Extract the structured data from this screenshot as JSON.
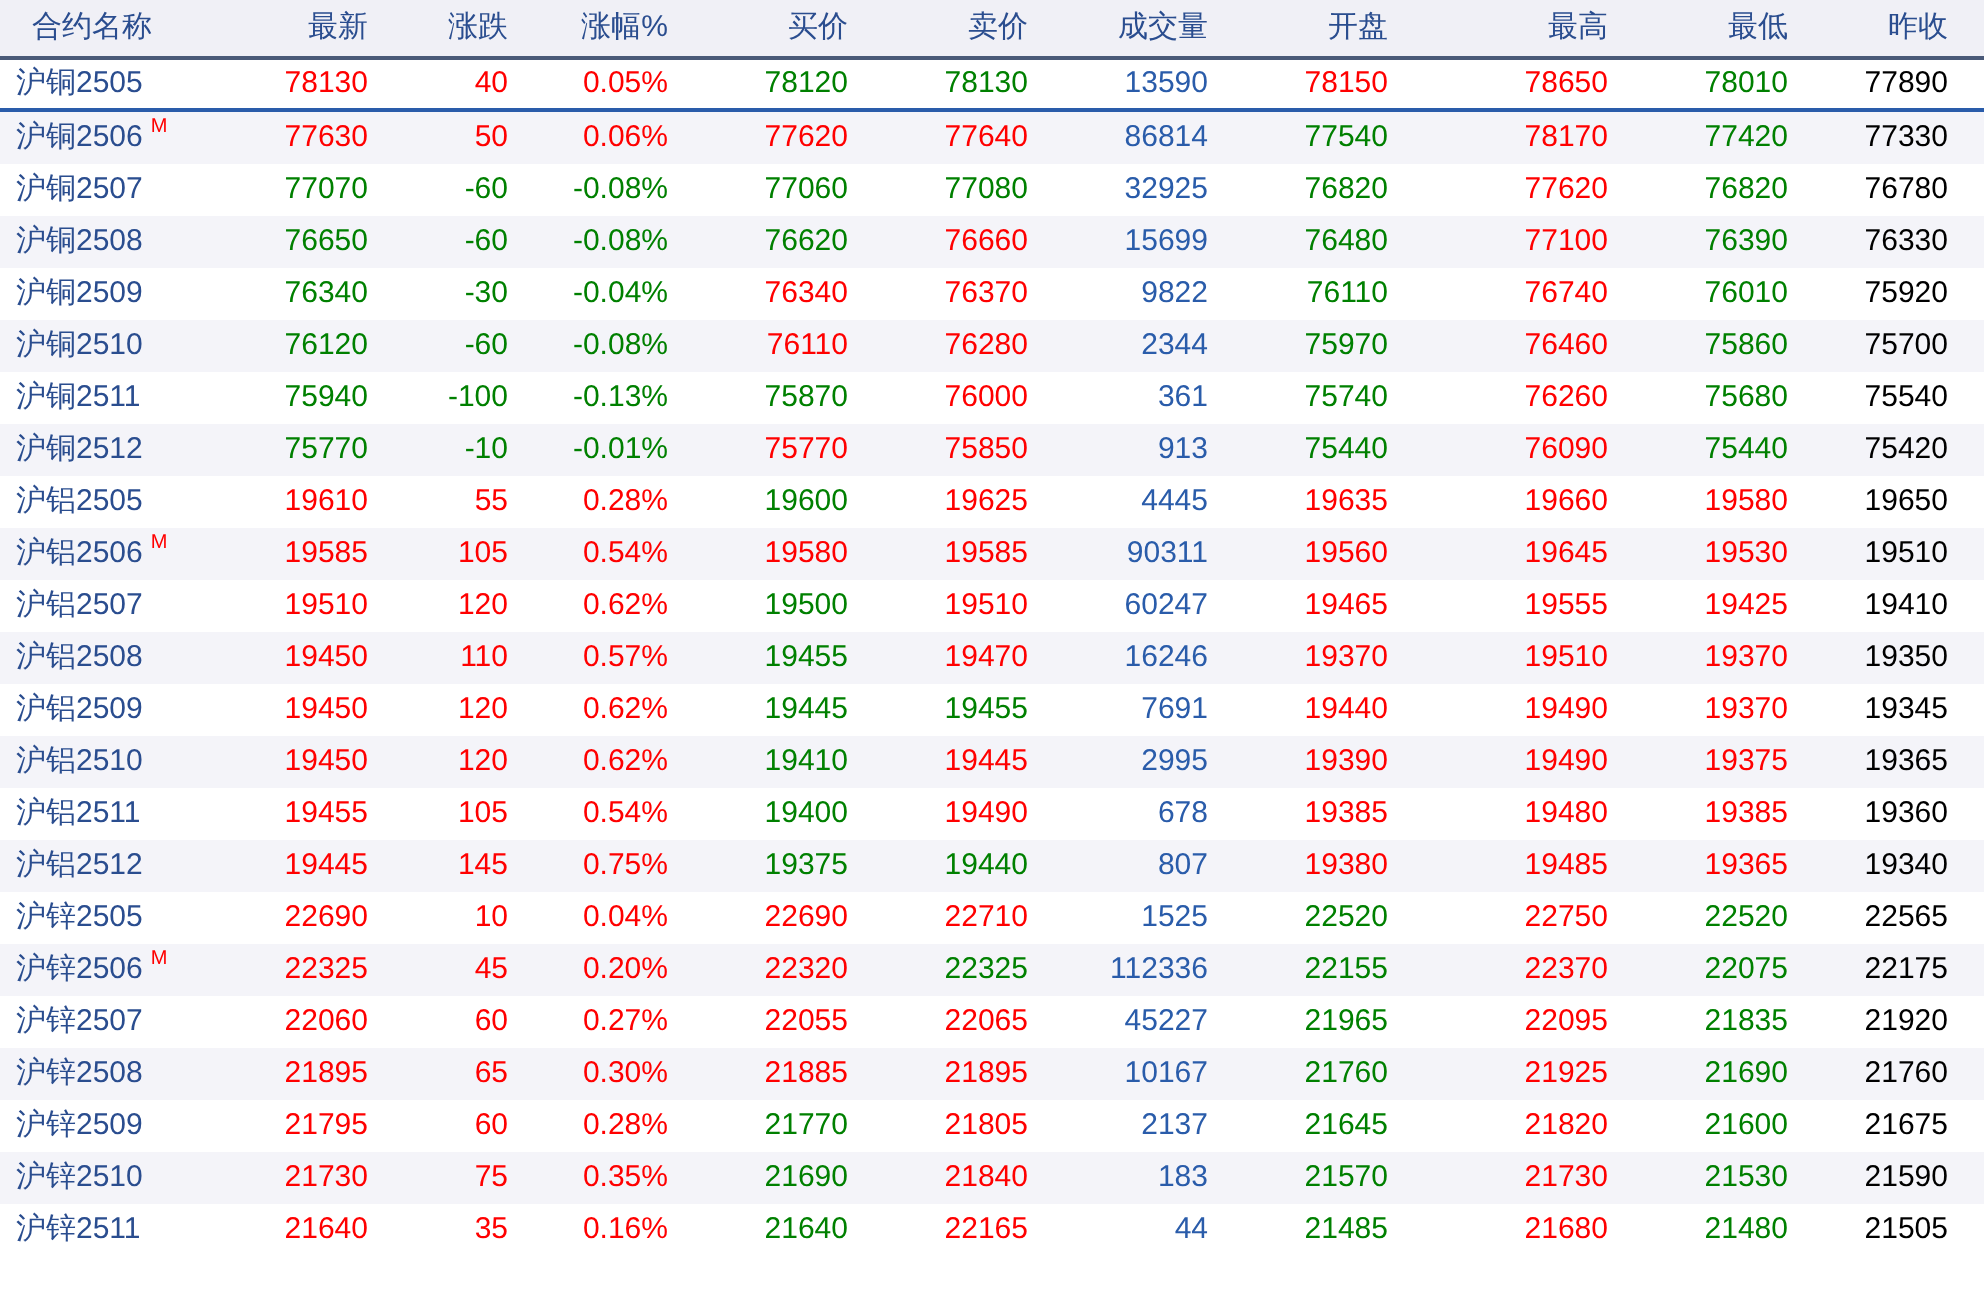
{
  "table": {
    "name_header": "合约名称",
    "columns": [
      "最新",
      "涨跌",
      "涨幅%",
      "买价",
      "卖价",
      "成交量",
      "开盘",
      "最高",
      "最低",
      "昨收"
    ],
    "rows": [
      {
        "name": "沪铜2505",
        "selected": true,
        "cells": [
          {
            "text": "78130",
            "color": "#ff0000"
          },
          {
            "text": "40",
            "color": "#ff0000"
          },
          {
            "text": "0.05%",
            "color": "#ff0000"
          },
          {
            "text": "78120",
            "color": "#008000"
          },
          {
            "text": "78130",
            "color": "#008000"
          },
          {
            "text": "13590",
            "color": "#2a5caa"
          },
          {
            "text": "78150",
            "color": "#ff0000"
          },
          {
            "text": "78650",
            "color": "#ff0000"
          },
          {
            "text": "78010",
            "color": "#008000"
          },
          {
            "text": "77890",
            "color": "#000000"
          }
        ]
      },
      {
        "name": "沪铜2506",
        "badge": "M",
        "selected": false,
        "cells": [
          {
            "text": "77630",
            "color": "#ff0000"
          },
          {
            "text": "50",
            "color": "#ff0000"
          },
          {
            "text": "0.06%",
            "color": "#ff0000"
          },
          {
            "text": "77620",
            "color": "#ff0000"
          },
          {
            "text": "77640",
            "color": "#ff0000"
          },
          {
            "text": "86814",
            "color": "#2a5caa"
          },
          {
            "text": "77540",
            "color": "#008000"
          },
          {
            "text": "78170",
            "color": "#ff0000"
          },
          {
            "text": "77420",
            "color": "#008000"
          },
          {
            "text": "77330",
            "color": "#000000"
          }
        ]
      },
      {
        "name": "沪铜2507",
        "selected": false,
        "cells": [
          {
            "text": "77070",
            "color": "#008000"
          },
          {
            "text": "-60",
            "color": "#008000"
          },
          {
            "text": "-0.08%",
            "color": "#008000"
          },
          {
            "text": "77060",
            "color": "#008000"
          },
          {
            "text": "77080",
            "color": "#008000"
          },
          {
            "text": "32925",
            "color": "#2a5caa"
          },
          {
            "text": "76820",
            "color": "#008000"
          },
          {
            "text": "77620",
            "color": "#ff0000"
          },
          {
            "text": "76820",
            "color": "#008000"
          },
          {
            "text": "76780",
            "color": "#000000"
          }
        ]
      },
      {
        "name": "沪铜2508",
        "selected": false,
        "cells": [
          {
            "text": "76650",
            "color": "#008000"
          },
          {
            "text": "-60",
            "color": "#008000"
          },
          {
            "text": "-0.08%",
            "color": "#008000"
          },
          {
            "text": "76620",
            "color": "#008000"
          },
          {
            "text": "76660",
            "color": "#ff0000"
          },
          {
            "text": "15699",
            "color": "#2a5caa"
          },
          {
            "text": "76480",
            "color": "#008000"
          },
          {
            "text": "77100",
            "color": "#ff0000"
          },
          {
            "text": "76390",
            "color": "#008000"
          },
          {
            "text": "76330",
            "color": "#000000"
          }
        ]
      },
      {
        "name": "沪铜2509",
        "selected": false,
        "cells": [
          {
            "text": "76340",
            "color": "#008000"
          },
          {
            "text": "-30",
            "color": "#008000"
          },
          {
            "text": "-0.04%",
            "color": "#008000"
          },
          {
            "text": "76340",
            "color": "#ff0000"
          },
          {
            "text": "76370",
            "color": "#ff0000"
          },
          {
            "text": "9822",
            "color": "#2a5caa"
          },
          {
            "text": "76110",
            "color": "#008000"
          },
          {
            "text": "76740",
            "color": "#ff0000"
          },
          {
            "text": "76010",
            "color": "#008000"
          },
          {
            "text": "75920",
            "color": "#000000"
          }
        ]
      },
      {
        "name": "沪铜2510",
        "selected": false,
        "cells": [
          {
            "text": "76120",
            "color": "#008000"
          },
          {
            "text": "-60",
            "color": "#008000"
          },
          {
            "text": "-0.08%",
            "color": "#008000"
          },
          {
            "text": "76110",
            "color": "#ff0000"
          },
          {
            "text": "76280",
            "color": "#ff0000"
          },
          {
            "text": "2344",
            "color": "#2a5caa"
          },
          {
            "text": "75970",
            "color": "#008000"
          },
          {
            "text": "76460",
            "color": "#ff0000"
          },
          {
            "text": "75860",
            "color": "#008000"
          },
          {
            "text": "75700",
            "color": "#000000"
          }
        ]
      },
      {
        "name": "沪铜2511",
        "selected": false,
        "cells": [
          {
            "text": "75940",
            "color": "#008000"
          },
          {
            "text": "-100",
            "color": "#008000"
          },
          {
            "text": "-0.13%",
            "color": "#008000"
          },
          {
            "text": "75870",
            "color": "#008000"
          },
          {
            "text": "76000",
            "color": "#ff0000"
          },
          {
            "text": "361",
            "color": "#2a5caa"
          },
          {
            "text": "75740",
            "color": "#008000"
          },
          {
            "text": "76260",
            "color": "#ff0000"
          },
          {
            "text": "75680",
            "color": "#008000"
          },
          {
            "text": "75540",
            "color": "#000000"
          }
        ]
      },
      {
        "name": "沪铜2512",
        "selected": false,
        "cells": [
          {
            "text": "75770",
            "color": "#008000"
          },
          {
            "text": "-10",
            "color": "#008000"
          },
          {
            "text": "-0.01%",
            "color": "#008000"
          },
          {
            "text": "75770",
            "color": "#ff0000"
          },
          {
            "text": "75850",
            "color": "#ff0000"
          },
          {
            "text": "913",
            "color": "#2a5caa"
          },
          {
            "text": "75440",
            "color": "#008000"
          },
          {
            "text": "76090",
            "color": "#ff0000"
          },
          {
            "text": "75440",
            "color": "#008000"
          },
          {
            "text": "75420",
            "color": "#000000"
          }
        ]
      },
      {
        "name": "沪铝2505",
        "selected": false,
        "cells": [
          {
            "text": "19610",
            "color": "#ff0000"
          },
          {
            "text": "55",
            "color": "#ff0000"
          },
          {
            "text": "0.28%",
            "color": "#ff0000"
          },
          {
            "text": "19600",
            "color": "#008000"
          },
          {
            "text": "19625",
            "color": "#ff0000"
          },
          {
            "text": "4445",
            "color": "#2a5caa"
          },
          {
            "text": "19635",
            "color": "#ff0000"
          },
          {
            "text": "19660",
            "color": "#ff0000"
          },
          {
            "text": "19580",
            "color": "#ff0000"
          },
          {
            "text": "19650",
            "color": "#000000"
          }
        ]
      },
      {
        "name": "沪铝2506",
        "badge": "M",
        "selected": false,
        "cells": [
          {
            "text": "19585",
            "color": "#ff0000"
          },
          {
            "text": "105",
            "color": "#ff0000"
          },
          {
            "text": "0.54%",
            "color": "#ff0000"
          },
          {
            "text": "19580",
            "color": "#ff0000"
          },
          {
            "text": "19585",
            "color": "#ff0000"
          },
          {
            "text": "90311",
            "color": "#2a5caa"
          },
          {
            "text": "19560",
            "color": "#ff0000"
          },
          {
            "text": "19645",
            "color": "#ff0000"
          },
          {
            "text": "19530",
            "color": "#ff0000"
          },
          {
            "text": "19510",
            "color": "#000000"
          }
        ]
      },
      {
        "name": "沪铝2507",
        "selected": false,
        "cells": [
          {
            "text": "19510",
            "color": "#ff0000"
          },
          {
            "text": "120",
            "color": "#ff0000"
          },
          {
            "text": "0.62%",
            "color": "#ff0000"
          },
          {
            "text": "19500",
            "color": "#008000"
          },
          {
            "text": "19510",
            "color": "#ff0000"
          },
          {
            "text": "60247",
            "color": "#2a5caa"
          },
          {
            "text": "19465",
            "color": "#ff0000"
          },
          {
            "text": "19555",
            "color": "#ff0000"
          },
          {
            "text": "19425",
            "color": "#ff0000"
          },
          {
            "text": "19410",
            "color": "#000000"
          }
        ]
      },
      {
        "name": "沪铝2508",
        "selected": false,
        "cells": [
          {
            "text": "19450",
            "color": "#ff0000"
          },
          {
            "text": "110",
            "color": "#ff0000"
          },
          {
            "text": "0.57%",
            "color": "#ff0000"
          },
          {
            "text": "19455",
            "color": "#008000"
          },
          {
            "text": "19470",
            "color": "#ff0000"
          },
          {
            "text": "16246",
            "color": "#2a5caa"
          },
          {
            "text": "19370",
            "color": "#ff0000"
          },
          {
            "text": "19510",
            "color": "#ff0000"
          },
          {
            "text": "19370",
            "color": "#ff0000"
          },
          {
            "text": "19350",
            "color": "#000000"
          }
        ]
      },
      {
        "name": "沪铝2509",
        "selected": false,
        "cells": [
          {
            "text": "19450",
            "color": "#ff0000"
          },
          {
            "text": "120",
            "color": "#ff0000"
          },
          {
            "text": "0.62%",
            "color": "#ff0000"
          },
          {
            "text": "19445",
            "color": "#008000"
          },
          {
            "text": "19455",
            "color": "#008000"
          },
          {
            "text": "7691",
            "color": "#2a5caa"
          },
          {
            "text": "19440",
            "color": "#ff0000"
          },
          {
            "text": "19490",
            "color": "#ff0000"
          },
          {
            "text": "19370",
            "color": "#ff0000"
          },
          {
            "text": "19345",
            "color": "#000000"
          }
        ]
      },
      {
        "name": "沪铝2510",
        "selected": false,
        "cells": [
          {
            "text": "19450",
            "color": "#ff0000"
          },
          {
            "text": "120",
            "color": "#ff0000"
          },
          {
            "text": "0.62%",
            "color": "#ff0000"
          },
          {
            "text": "19410",
            "color": "#008000"
          },
          {
            "text": "19445",
            "color": "#ff0000"
          },
          {
            "text": "2995",
            "color": "#2a5caa"
          },
          {
            "text": "19390",
            "color": "#ff0000"
          },
          {
            "text": "19490",
            "color": "#ff0000"
          },
          {
            "text": "19375",
            "color": "#ff0000"
          },
          {
            "text": "19365",
            "color": "#000000"
          }
        ]
      },
      {
        "name": "沪铝2511",
        "selected": false,
        "cells": [
          {
            "text": "19455",
            "color": "#ff0000"
          },
          {
            "text": "105",
            "color": "#ff0000"
          },
          {
            "text": "0.54%",
            "color": "#ff0000"
          },
          {
            "text": "19400",
            "color": "#008000"
          },
          {
            "text": "19490",
            "color": "#ff0000"
          },
          {
            "text": "678",
            "color": "#2a5caa"
          },
          {
            "text": "19385",
            "color": "#ff0000"
          },
          {
            "text": "19480",
            "color": "#ff0000"
          },
          {
            "text": "19385",
            "color": "#ff0000"
          },
          {
            "text": "19360",
            "color": "#000000"
          }
        ]
      },
      {
        "name": "沪铝2512",
        "selected": false,
        "cells": [
          {
            "text": "19445",
            "color": "#ff0000"
          },
          {
            "text": "145",
            "color": "#ff0000"
          },
          {
            "text": "0.75%",
            "color": "#ff0000"
          },
          {
            "text": "19375",
            "color": "#008000"
          },
          {
            "text": "19440",
            "color": "#008000"
          },
          {
            "text": "807",
            "color": "#2a5caa"
          },
          {
            "text": "19380",
            "color": "#ff0000"
          },
          {
            "text": "19485",
            "color": "#ff0000"
          },
          {
            "text": "19365",
            "color": "#ff0000"
          },
          {
            "text": "19340",
            "color": "#000000"
          }
        ]
      },
      {
        "name": "沪锌2505",
        "selected": false,
        "cells": [
          {
            "text": "22690",
            "color": "#ff0000"
          },
          {
            "text": "10",
            "color": "#ff0000"
          },
          {
            "text": "0.04%",
            "color": "#ff0000"
          },
          {
            "text": "22690",
            "color": "#ff0000"
          },
          {
            "text": "22710",
            "color": "#ff0000"
          },
          {
            "text": "1525",
            "color": "#2a5caa"
          },
          {
            "text": "22520",
            "color": "#008000"
          },
          {
            "text": "22750",
            "color": "#ff0000"
          },
          {
            "text": "22520",
            "color": "#008000"
          },
          {
            "text": "22565",
            "color": "#000000"
          }
        ]
      },
      {
        "name": "沪锌2506",
        "badge": "M",
        "selected": false,
        "cells": [
          {
            "text": "22325",
            "color": "#ff0000"
          },
          {
            "text": "45",
            "color": "#ff0000"
          },
          {
            "text": "0.20%",
            "color": "#ff0000"
          },
          {
            "text": "22320",
            "color": "#ff0000"
          },
          {
            "text": "22325",
            "color": "#008000"
          },
          {
            "text": "112336",
            "color": "#2a5caa"
          },
          {
            "text": "22155",
            "color": "#008000"
          },
          {
            "text": "22370",
            "color": "#ff0000"
          },
          {
            "text": "22075",
            "color": "#008000"
          },
          {
            "text": "22175",
            "color": "#000000"
          }
        ]
      },
      {
        "name": "沪锌2507",
        "selected": false,
        "cells": [
          {
            "text": "22060",
            "color": "#ff0000"
          },
          {
            "text": "60",
            "color": "#ff0000"
          },
          {
            "text": "0.27%",
            "color": "#ff0000"
          },
          {
            "text": "22055",
            "color": "#ff0000"
          },
          {
            "text": "22065",
            "color": "#ff0000"
          },
          {
            "text": "45227",
            "color": "#2a5caa"
          },
          {
            "text": "21965",
            "color": "#008000"
          },
          {
            "text": "22095",
            "color": "#ff0000"
          },
          {
            "text": "21835",
            "color": "#008000"
          },
          {
            "text": "21920",
            "color": "#000000"
          }
        ]
      },
      {
        "name": "沪锌2508",
        "selected": false,
        "cells": [
          {
            "text": "21895",
            "color": "#ff0000"
          },
          {
            "text": "65",
            "color": "#ff0000"
          },
          {
            "text": "0.30%",
            "color": "#ff0000"
          },
          {
            "text": "21885",
            "color": "#ff0000"
          },
          {
            "text": "21895",
            "color": "#ff0000"
          },
          {
            "text": "10167",
            "color": "#2a5caa"
          },
          {
            "text": "21760",
            "color": "#008000"
          },
          {
            "text": "21925",
            "color": "#ff0000"
          },
          {
            "text": "21690",
            "color": "#008000"
          },
          {
            "text": "21760",
            "color": "#000000"
          }
        ]
      },
      {
        "name": "沪锌2509",
        "selected": false,
        "cells": [
          {
            "text": "21795",
            "color": "#ff0000"
          },
          {
            "text": "60",
            "color": "#ff0000"
          },
          {
            "text": "0.28%",
            "color": "#ff0000"
          },
          {
            "text": "21770",
            "color": "#008000"
          },
          {
            "text": "21805",
            "color": "#ff0000"
          },
          {
            "text": "2137",
            "color": "#2a5caa"
          },
          {
            "text": "21645",
            "color": "#008000"
          },
          {
            "text": "21820",
            "color": "#ff0000"
          },
          {
            "text": "21600",
            "color": "#008000"
          },
          {
            "text": "21675",
            "color": "#000000"
          }
        ]
      },
      {
        "name": "沪锌2510",
        "selected": false,
        "cells": [
          {
            "text": "21730",
            "color": "#ff0000"
          },
          {
            "text": "75",
            "color": "#ff0000"
          },
          {
            "text": "0.35%",
            "color": "#ff0000"
          },
          {
            "text": "21690",
            "color": "#008000"
          },
          {
            "text": "21840",
            "color": "#ff0000"
          },
          {
            "text": "183",
            "color": "#2a5caa"
          },
          {
            "text": "21570",
            "color": "#008000"
          },
          {
            "text": "21730",
            "color": "#ff0000"
          },
          {
            "text": "21530",
            "color": "#008000"
          },
          {
            "text": "21590",
            "color": "#000000"
          }
        ]
      },
      {
        "name": "沪锌2511",
        "selected": false,
        "cells": [
          {
            "text": "21640",
            "color": "#ff0000"
          },
          {
            "text": "35",
            "color": "#ff0000"
          },
          {
            "text": "0.16%",
            "color": "#ff0000"
          },
          {
            "text": "21640",
            "color": "#008000"
          },
          {
            "text": "22165",
            "color": "#ff0000"
          },
          {
            "text": "44",
            "color": "#2a5caa"
          },
          {
            "text": "21485",
            "color": "#008000"
          },
          {
            "text": "21680",
            "color": "#ff0000"
          },
          {
            "text": "21480",
            "color": "#008000"
          },
          {
            "text": "21505",
            "color": "#000000"
          }
        ]
      }
    ]
  }
}
